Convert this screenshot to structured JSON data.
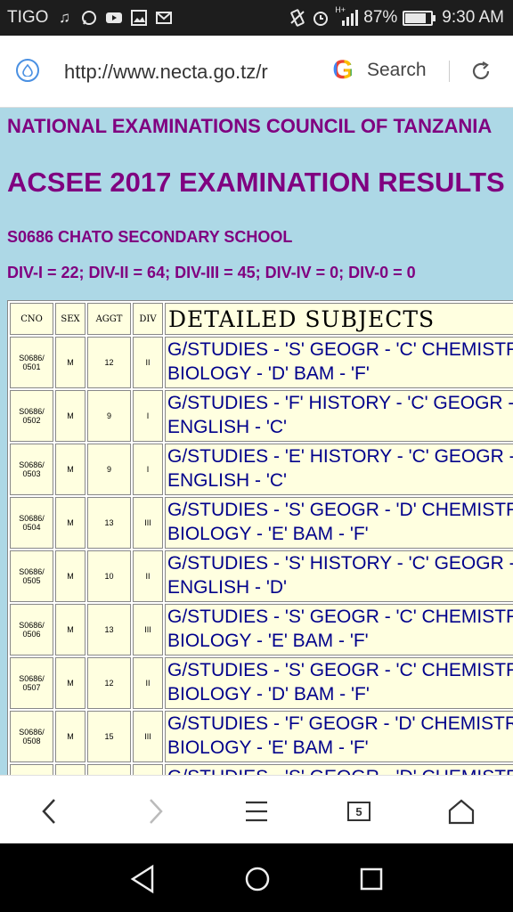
{
  "status_bar": {
    "carrier": "TIGO",
    "network": "H+",
    "battery": "87%",
    "battery_level": 0.87,
    "time": "9:30 AM"
  },
  "browser": {
    "url": "http://www.necta.go.tz/r",
    "search_label": "Search",
    "tab_count": "5"
  },
  "page": {
    "council": "NATIONAL EXAMINATIONS COUNCIL OF TANZANIA",
    "exam_title": "ACSEE 2017 EXAMINATION RESULTS",
    "school": "S0686 CHATO SECONDARY SCHOOL",
    "division_summary": "DIV-I = 22; DIV-II = 64; DIV-III = 45; DIV-IV = 0; DIV-0 = 0"
  },
  "table": {
    "headers": {
      "cno": "CNO",
      "sex": "SEX",
      "aggt": "AGGT",
      "div": "DIV",
      "subjects": "DETAILED SUBJECTS"
    },
    "rows": [
      {
        "cno_a": "S0686/",
        "cno_b": "0501",
        "sex": "M",
        "aggt": "12",
        "div": "II",
        "line1": "G/STUDIES - 'S' GEOGR - 'C' CHEMISTR",
        "line2": "BIOLOGY - 'D' BAM - 'F'"
      },
      {
        "cno_a": "S0686/",
        "cno_b": "0502",
        "sex": "M",
        "aggt": "9",
        "div": "I",
        "line1": "G/STUDIES - 'F' HISTORY - 'C' GEOGR -",
        "line2": "ENGLISH - 'C'"
      },
      {
        "cno_a": "S0686/",
        "cno_b": "0503",
        "sex": "M",
        "aggt": "9",
        "div": "I",
        "line1": "G/STUDIES - 'E' HISTORY - 'C' GEOGR -",
        "line2": "ENGLISH - 'C'"
      },
      {
        "cno_a": "S0686/",
        "cno_b": "0504",
        "sex": "M",
        "aggt": "13",
        "div": "III",
        "line1": "G/STUDIES - 'S' GEOGR - 'D' CHEMISTR",
        "line2": "BIOLOGY - 'E' BAM - 'F'"
      },
      {
        "cno_a": "S0686/",
        "cno_b": "0505",
        "sex": "M",
        "aggt": "10",
        "div": "II",
        "line1": "G/STUDIES - 'S' HISTORY - 'C' GEOGR -",
        "line2": "ENGLISH - 'D'"
      },
      {
        "cno_a": "S0686/",
        "cno_b": "0506",
        "sex": "M",
        "aggt": "13",
        "div": "III",
        "line1": "G/STUDIES - 'S' GEOGR - 'C' CHEMISTR",
        "line2": "BIOLOGY - 'E' BAM - 'F'"
      },
      {
        "cno_a": "S0686/",
        "cno_b": "0507",
        "sex": "M",
        "aggt": "12",
        "div": "II",
        "line1": "G/STUDIES - 'S' GEOGR - 'C' CHEMISTR",
        "line2": "BIOLOGY - 'D' BAM - 'F'"
      },
      {
        "cno_a": "S0686/",
        "cno_b": "0508",
        "sex": "M",
        "aggt": "15",
        "div": "III",
        "line1": "G/STUDIES - 'F' GEOGR - 'D' CHEMISTR",
        "line2": "BIOLOGY - 'E' BAM - 'F'"
      },
      {
        "cno_a": "",
        "cno_b": "",
        "sex": "",
        "aggt": "",
        "div": "",
        "line1": "G/STUDIES - 'S' GEOGR - 'D' CHEMISTR",
        "line2": ""
      }
    ]
  },
  "icons": {
    "status_left": [
      "music-icon",
      "whatsapp-icon",
      "youtube-icon",
      "gallery-icon",
      "gmail-icon"
    ],
    "status_right": [
      "vibrate-icon",
      "alarm-icon",
      "signal-icon",
      "battery-icon"
    ],
    "browser_bottom": [
      "back-icon",
      "forward-icon",
      "menu-icon",
      "tabs-icon",
      "home-icon"
    ],
    "system_nav": [
      "nav-back-icon",
      "nav-home-icon",
      "nav-recents-icon"
    ]
  },
  "colors": {
    "page_background": "#add8e6",
    "heading": "#800080",
    "subjects_text": "#00008b",
    "cell_background": "#ffffe0"
  }
}
